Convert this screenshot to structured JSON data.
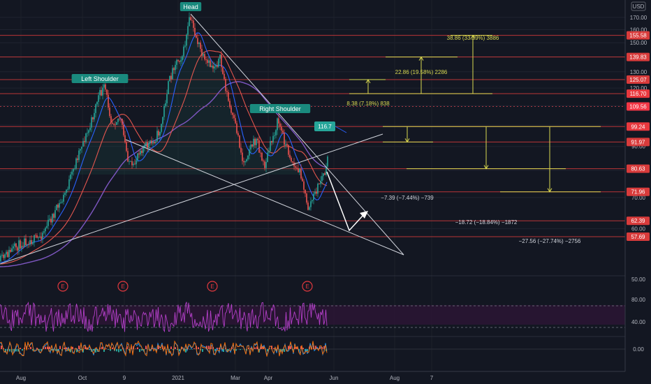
{
  "currency": "USD",
  "chart_data": [
    {
      "type": "candlestick",
      "title": "",
      "y_scale": "log",
      "ylim": [
        55,
        178
      ],
      "y_ticks": [
        60,
        70,
        80,
        90,
        100,
        110,
        120,
        130,
        140,
        150,
        160,
        170
      ],
      "x_ticks": [
        "Aug",
        "Oct",
        "9",
        "2021",
        "Mar",
        "Apr",
        "Jun",
        "Aug",
        "7"
      ],
      "price_path": [
        [
          "Jul 2020",
          57
        ],
        [
          "Aug 2020",
          62
        ],
        [
          "mid Aug 2020",
          66
        ],
        [
          "Sep 2020",
          80
        ],
        [
          "Oct 2020",
          128
        ],
        [
          "Oct 2020",
          140
        ],
        [
          "Nov 2020",
          106
        ],
        [
          "Nov 2020",
          122
        ],
        [
          "Dec 2020",
          98
        ],
        [
          "Dec 2020",
          115
        ],
        [
          "Jan 2021",
          150
        ],
        [
          "Jan 2021",
          172
        ],
        [
          "Feb 2021",
          148
        ],
        [
          "Feb 2021",
          155
        ],
        [
          "Mar 2021",
          115
        ],
        [
          "Mar 2021",
          97
        ],
        [
          "Apr 2021",
          125
        ],
        [
          "Apr 2021",
          118
        ],
        [
          "May 2021",
          83
        ],
        [
          "May 2021",
          100
        ],
        [
          "Jun 2021",
          109.56
        ]
      ],
      "last_price": 109.56,
      "series": [
        {
          "name": "",
          "color": "#26a69a"
        },
        {
          "name": "",
          "color": "#ef5350"
        },
        {
          "name": "",
          "color": "#2962ff"
        },
        {
          "name": "",
          "color": "#e2564e"
        },
        {
          "name": "",
          "color": "#7e57c2"
        }
      ],
      "pattern_labels": [
        "Head",
        "Left Shoulder",
        "Right Shoulder"
      ],
      "horizontal_levels": [
        155.58,
        139.83,
        125.07,
        116.7,
        109.56,
        99.24,
        91.97,
        80.63,
        71.96,
        62.39,
        57.69
      ],
      "price_badge": 116.7,
      "measurements": [
        {
          "text": "38.86 (33.29%) 3886",
          "from": 116.7,
          "to": 155.58
        },
        {
          "text": "22.86 (19.58%) 2286",
          "from": 116.7,
          "to": 139.83
        },
        {
          "text": "8.38 (7.18%) 838",
          "from": 116.7,
          "to": 125.07
        },
        {
          "text": "−7.39 (−7.44%) −739",
          "from": 99.24,
          "to": 91.97
        },
        {
          "text": "−18.72 (−18.84%) −1872",
          "from": 99.24,
          "to": 80.63
        },
        {
          "text": "−27.56 (−27.74%) −2756",
          "from": 99.24,
          "to": 71.96
        }
      ],
      "earnings_markers": [
        "E",
        "E",
        "E",
        "E"
      ]
    },
    {
      "type": "line",
      "title": "",
      "ylim": [
        20,
        95
      ],
      "y_ticks": [
        40.0,
        80.0
      ],
      "band": [
        35,
        70
      ],
      "series": [
        {
          "name": "",
          "color": "#b33fc8"
        }
      ]
    },
    {
      "type": "histogram",
      "title": "",
      "y_ticks": [
        0.0
      ],
      "series": [
        {
          "name": "",
          "color": "#2196f3"
        },
        {
          "name": "",
          "color": "#ff6d00"
        },
        {
          "name": "",
          "color": "#26a69a"
        }
      ]
    }
  ]
}
